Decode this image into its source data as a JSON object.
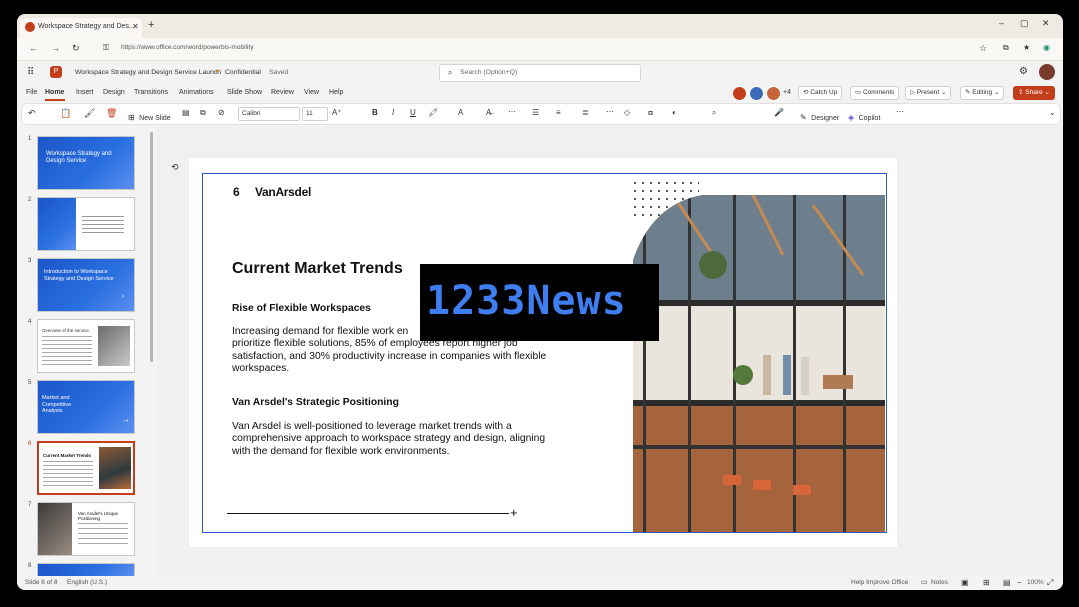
{
  "browser": {
    "tab_title": "Workspace Strategy and Des...",
    "url": "https://www.office.com/word/powerbis-mobility"
  },
  "app": {
    "doc_title": "Workspace Strategy and Design Service Launch",
    "sensitivity": "Confidential",
    "saved": "Saved",
    "search_placeholder": "Search (Option+Q)",
    "collab_more": "+4",
    "catch_up": "Catch Up",
    "comments": "Comments",
    "present": "Present",
    "editing": "Editing",
    "share": "Share"
  },
  "menu": [
    "File",
    "Home",
    "Insert",
    "Design",
    "Transitions",
    "Animations",
    "Slide Show",
    "Review",
    "View",
    "Help"
  ],
  "ribbon": {
    "new_slide": "New Slide",
    "font": "Calibri",
    "size": "11",
    "designer": "Designer",
    "copilot": "Copilot"
  },
  "thumbnails": [
    {
      "num": "1",
      "title": "Workspace Strategy and Design Service"
    },
    {
      "num": "2",
      "title": ""
    },
    {
      "num": "3",
      "title": "Introduction to Workspace Strategy and Design Service"
    },
    {
      "num": "4",
      "title": "Overview of the service"
    },
    {
      "num": "5",
      "title": "Market and Competitive Analysis"
    },
    {
      "num": "6",
      "title": "Current Market Trends"
    },
    {
      "num": "7",
      "title": "Van Arsdel's Unique Positioning"
    },
    {
      "num": "8",
      "title": ""
    }
  ],
  "slide": {
    "number": "6",
    "logo": "VanArsdel",
    "title": "Current Market Trends",
    "h1": "Rise of Flexible Workspaces",
    "p1": [
      "Increasing demand for flexible work en",
      "prioritize flexible solutions, 85% of employees report higher job",
      "satisfaction, and 30% productivity increase in companies with flexible",
      "workspaces."
    ],
    "h2": "Van Arsdel's Strategic Positioning",
    "p2": [
      "Van Arsdel is well-positioned to leverage market trends with a",
      "comprehensive approach to workspace strategy and design, aligning",
      "with the demand for flexible work environments."
    ]
  },
  "watermark": "1233News",
  "status": {
    "slide_of": "Slide 6 of 8",
    "language": "English (U.S.)",
    "help": "Help Improve Office",
    "notes": "Notes",
    "zoom": "100%"
  }
}
